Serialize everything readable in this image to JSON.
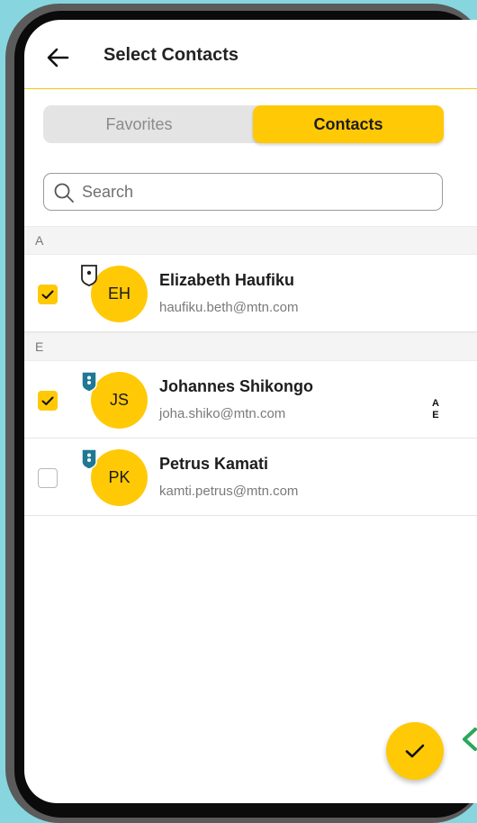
{
  "header": {
    "title": "Select Contacts",
    "back_icon": "arrow-left-icon"
  },
  "tabs": [
    {
      "label": "Favorites",
      "selected": false
    },
    {
      "label": "Contacts",
      "selected": true
    }
  ],
  "search": {
    "placeholder": "Search",
    "value": ""
  },
  "sections": [
    {
      "letter": "A",
      "contacts": [
        {
          "initials": "EH",
          "name": "Elizabeth Haufiku",
          "email": "haufiku.beth@mtn.com",
          "checked": true,
          "badge": "shield-outline-icon"
        }
      ]
    },
    {
      "letter": "E",
      "contacts": [
        {
          "initials": "JS",
          "name": "Johannes Shikongo",
          "email": "joha.shiko@mtn.com",
          "checked": true,
          "badge": "shield-blue-icon"
        },
        {
          "initials": "PK",
          "name": "Petrus Kamati",
          "email": "kamti.petrus@mtn.com",
          "checked": false,
          "badge": "shield-blue-icon"
        }
      ]
    }
  ],
  "index_bar": [
    "A",
    "E"
  ],
  "colors": {
    "accent": "#ffc906",
    "badge_blue": "#1f7894",
    "divider": "#f4c41a"
  }
}
